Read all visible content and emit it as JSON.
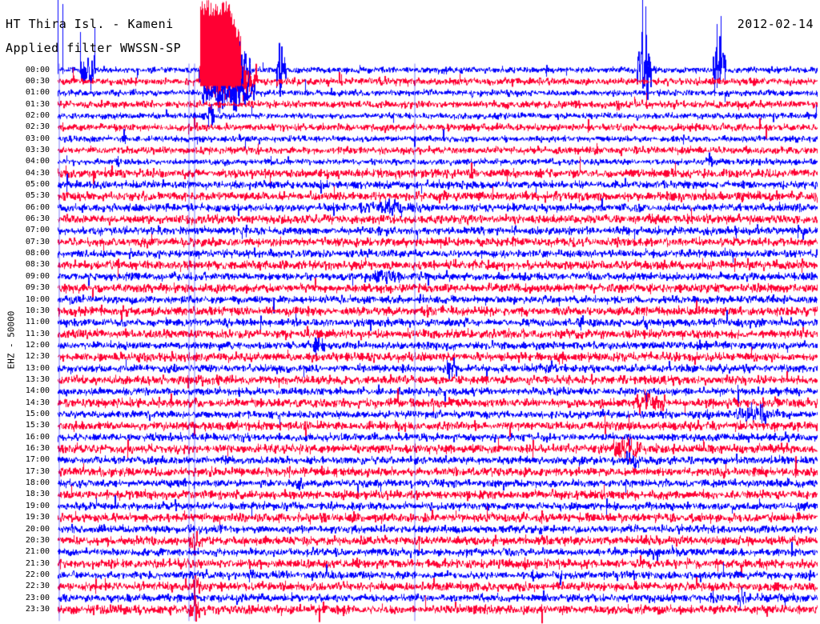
{
  "header": {
    "title": "HT Thira Isl. - Kameni",
    "filter": "Applied filter WWSSN-SP",
    "date": "2012-02-14"
  },
  "chart_data": {
    "type": "helicorder",
    "ylabel": "EHZ - 50000",
    "row_colors": [
      "#0000ff",
      "#ff0033"
    ],
    "tick_labels": [
      "00:00",
      "00:30",
      "01:00",
      "01:30",
      "02:00",
      "02:30",
      "03:00",
      "03:30",
      "04:00",
      "04:30",
      "05:00",
      "05:30",
      "06:00",
      "06:30",
      "07:00",
      "07:30",
      "08:00",
      "08:30",
      "09:00",
      "09:30",
      "10:00",
      "10:30",
      "11:00",
      "11:30",
      "12:00",
      "12:30",
      "13:00",
      "13:30",
      "14:00",
      "14:30",
      "15:00",
      "15:30",
      "16:00",
      "16:30",
      "17:00",
      "17:30",
      "18:00",
      "18:30",
      "19:00",
      "19:30",
      "20:00",
      "20:30",
      "21:00",
      "21:30",
      "22:00",
      "22:30",
      "23:00",
      "23:30"
    ]
  }
}
